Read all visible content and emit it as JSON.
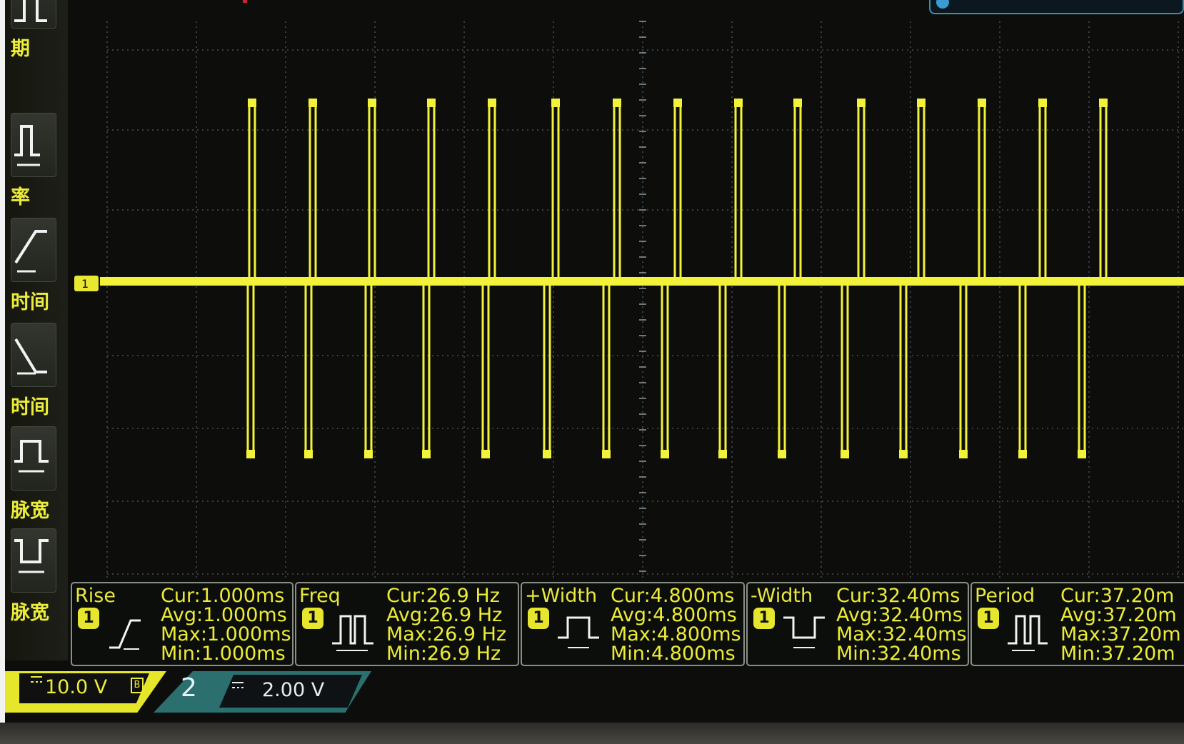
{
  "side_menu": {
    "items": [
      {
        "label": "期",
        "icon": "positive-pulse-icon"
      },
      {
        "label": "率",
        "icon": "frequency-pulse-icon"
      },
      {
        "label": "时间",
        "icon": "rise-edge-icon"
      },
      {
        "label": "时间",
        "icon": "fall-edge-icon"
      },
      {
        "label": "脉宽",
        "icon": "positive-width-icon"
      },
      {
        "label": "脉宽",
        "icon": "negative-width-icon"
      }
    ]
  },
  "trace": {
    "channel_marker": "1",
    "color": "#f2f23a",
    "baseline_level": 0,
    "pulse_high": 5,
    "pulse_low": -5,
    "pulse_count_high": 15,
    "pulse_count_low": 15
  },
  "measurements": [
    {
      "name": "Rise",
      "channel": "1",
      "icon": "rise-edge-icon",
      "cur": "Cur:1.000ms",
      "avg": "Avg:1.000ms",
      "max": "Max:1.000ms",
      "min": "Min:1.000ms"
    },
    {
      "name": "Freq",
      "channel": "1",
      "icon": "frequency-pulse-icon",
      "cur": "Cur:26.9 Hz",
      "avg": "Avg:26.9 Hz",
      "max": "Max:26.9 Hz",
      "min": "Min:26.9 Hz"
    },
    {
      "name": "+Width",
      "channel": "1",
      "icon": "positive-width-icon",
      "cur": "Cur:4.800ms",
      "avg": "Avg:4.800ms",
      "max": "Max:4.800ms",
      "min": "Min:4.800ms"
    },
    {
      "name": "-Width",
      "channel": "1",
      "icon": "negative-width-icon",
      "cur": "Cur:32.40ms",
      "avg": "Avg:32.40ms",
      "max": "Max:32.40ms",
      "min": "Min:32.40ms"
    },
    {
      "name": "Period",
      "channel": "1",
      "icon": "period-pulse-icon",
      "cur": "Cur:37.20m",
      "avg": "Avg:37.20m",
      "max": "Max:37.20m",
      "min": "Min:37.20m"
    }
  ],
  "channels": {
    "ch1": {
      "scale": "10.0 V",
      "coupling": "DC",
      "color": "#e6e62a"
    },
    "ch2": {
      "number": "2",
      "scale": "2.00 V",
      "coupling": "DC",
      "color": "#2b6f6f"
    }
  },
  "colors": {
    "trace": "#f2f23a",
    "grid": "#8b9aa6",
    "background": "#0d0e0b",
    "text": "#ecec38"
  }
}
